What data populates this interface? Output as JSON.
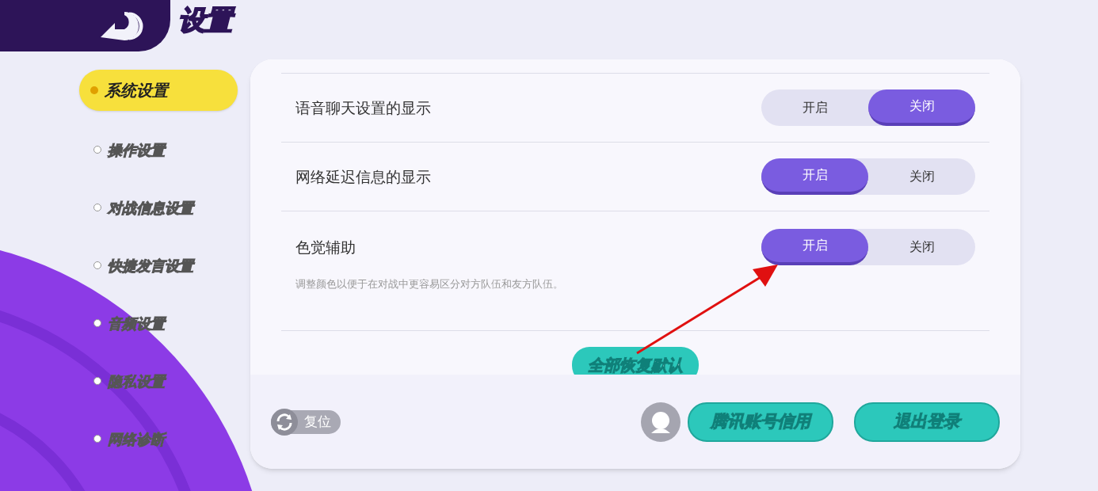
{
  "header": {
    "title": "设置"
  },
  "sidebar": {
    "items": [
      {
        "label": "系统设置",
        "selected": true
      },
      {
        "label": "操作设置",
        "selected": false
      },
      {
        "label": "对战信息设置",
        "selected": false
      },
      {
        "label": "快捷发言设置",
        "selected": false
      },
      {
        "label": "音频设置",
        "selected": false
      },
      {
        "label": "隐私设置",
        "selected": false
      },
      {
        "label": "网络诊断",
        "selected": false
      }
    ]
  },
  "settings": [
    {
      "label": "语音聊天设置的显示",
      "options": [
        {
          "label": "开启",
          "selected": false
        },
        {
          "label": "关闭",
          "selected": true
        }
      ]
    },
    {
      "label": "网络延迟信息的显示",
      "options": [
        {
          "label": "开启",
          "selected": true
        },
        {
          "label": "关闭",
          "selected": false
        }
      ]
    },
    {
      "label": "色觉辅助",
      "description": "调整颜色以便于在对战中更容易区分对方队伍和友方队伍。",
      "options": [
        {
          "label": "开启",
          "selected": true
        },
        {
          "label": "关闭",
          "selected": false
        }
      ]
    }
  ],
  "restore_button": "全部恢复默认",
  "footer": {
    "reset_button": "复位",
    "account_button": "腾讯账号信用",
    "logout_button": "退出登录"
  }
}
